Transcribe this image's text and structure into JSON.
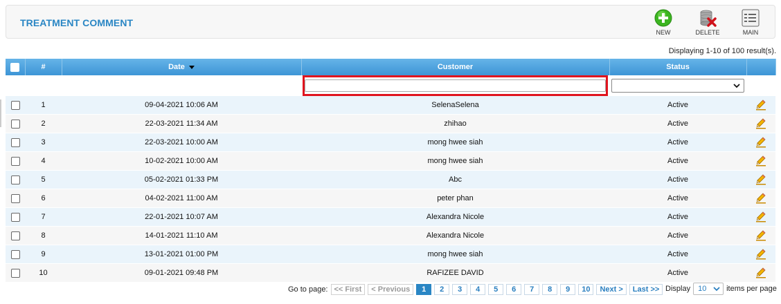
{
  "page": {
    "title": "TREATMENT COMMENT"
  },
  "toolbar": {
    "new_label": "NEW",
    "delete_label": "DELETE",
    "main_label": "MAIN",
    "new_icon": "add-circle-icon",
    "delete_icon": "delete-database-icon",
    "main_icon": "menu-list-icon"
  },
  "results": {
    "display_text": "Displaying 1-10 of 100 result(s)."
  },
  "table": {
    "columns": {
      "num": "#",
      "date": "Date",
      "customer": "Customer",
      "status": "Status"
    },
    "sort": {
      "column": "date",
      "direction": "desc"
    },
    "filter": {
      "customer_value": "",
      "status_value": ""
    },
    "rows": [
      {
        "num": "1",
        "date": "09-04-2021 10:06 AM",
        "customer": "SelenaSelena",
        "status": "Active"
      },
      {
        "num": "2",
        "date": "22-03-2021 11:34 AM",
        "customer": "zhihao",
        "status": "Active"
      },
      {
        "num": "3",
        "date": "22-03-2021 10:00 AM",
        "customer": "mong hwee siah",
        "status": "Active"
      },
      {
        "num": "4",
        "date": "10-02-2021 10:00 AM",
        "customer": "mong hwee siah",
        "status": "Active"
      },
      {
        "num": "5",
        "date": "05-02-2021 01:33 PM",
        "customer": "Abc",
        "status": "Active"
      },
      {
        "num": "6",
        "date": "04-02-2021 11:00 AM",
        "customer": "peter phan",
        "status": "Active"
      },
      {
        "num": "7",
        "date": "22-01-2021 10:07 AM",
        "customer": "Alexandra Nicole",
        "status": "Active"
      },
      {
        "num": "8",
        "date": "14-01-2021 11:10 AM",
        "customer": "Alexandra Nicole",
        "status": "Active"
      },
      {
        "num": "9",
        "date": "13-01-2021 01:00 PM",
        "customer": "mong hwee siah",
        "status": "Active"
      },
      {
        "num": "10",
        "date": "09-01-2021 09:48 PM",
        "customer": "RAFIZEE DAVID",
        "status": "Active"
      }
    ]
  },
  "pagination": {
    "goto_label": "Go to page:",
    "first": "<< First",
    "previous": "< Previous",
    "pages": [
      "1",
      "2",
      "3",
      "4",
      "5",
      "6",
      "7",
      "8",
      "9",
      "10"
    ],
    "current": "1",
    "next": "Next >",
    "last": "Last >>",
    "display_label": "Display",
    "per_page_value": "10",
    "per_page_suffix": "items per page"
  },
  "colors": {
    "accent": "#2a86c4",
    "header_top": "#66b4e8",
    "header_bottom": "#3d95d6",
    "highlight_border": "#e0141e",
    "row_odd": "#eaf4fb",
    "row_even": "#f6f6f6"
  }
}
